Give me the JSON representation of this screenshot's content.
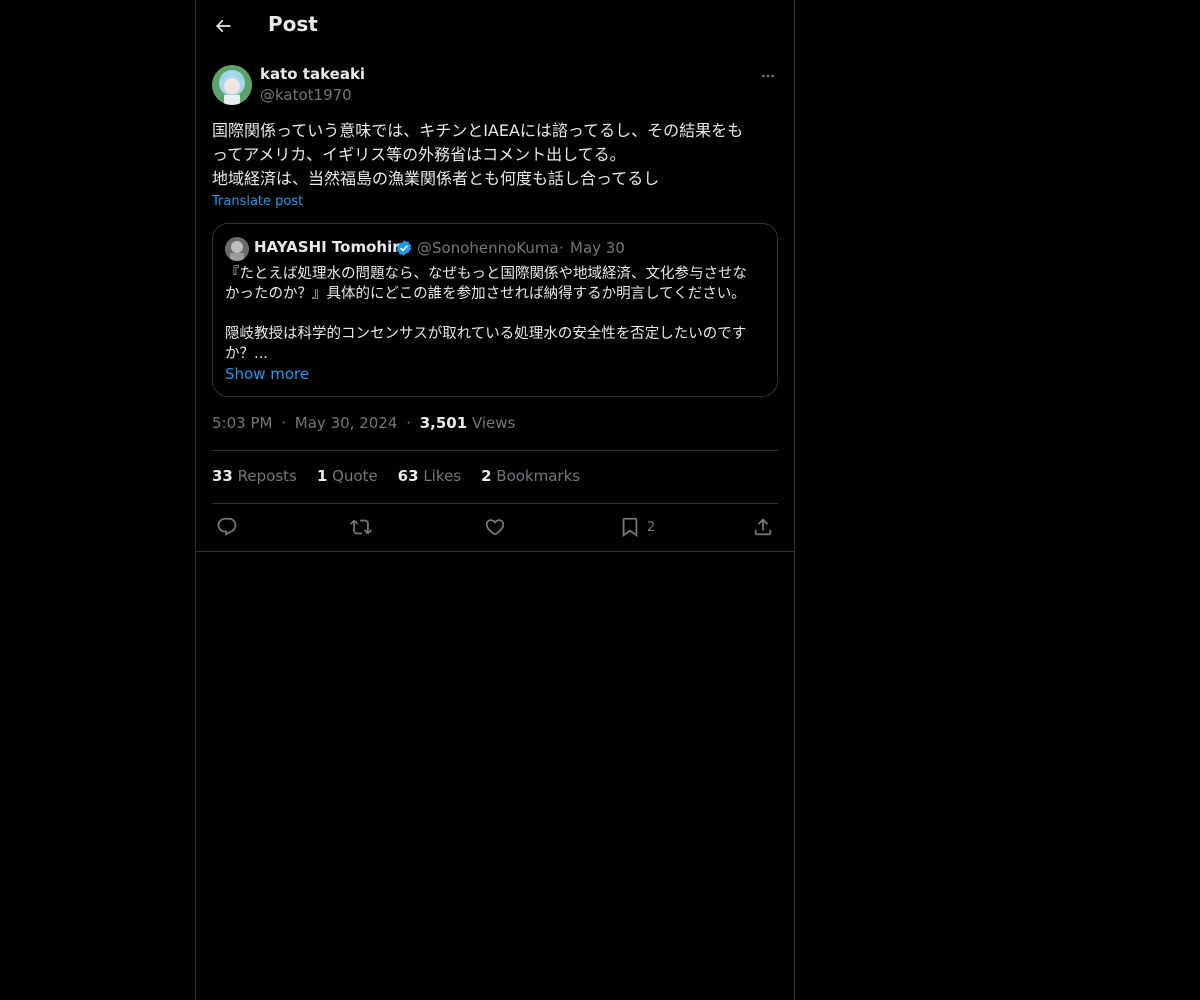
{
  "header": {
    "title": "Post",
    "back_icon": "arrow-left-icon"
  },
  "post": {
    "author_name": "kato takeaki",
    "author_handle": "@katot1970",
    "more_icon": "more-dots-icon",
    "body_lines": [
      "国際関係っていう意味では、キチンとIAEAには諮ってるし、その結果をも",
      "ってアメリカ、イギリス等の外務省はコメント出してる。",
      "地域経済は、当然福島の漁業関係者とも何度も話し合ってるし"
    ],
    "translate_label": "Translate post"
  },
  "quote": {
    "author_name": "HAYASHI Tomohiro",
    "verified_icon": "verified-badge-icon",
    "author_handle": "@SonohennoKuma",
    "separator": "·",
    "date": "May 30",
    "text_lines": [
      "『たとえば処理水の問題なら、なぜもっと国際関係や地域経済、文化参与させな",
      "かったのか？』具体的にどこの誰を参加させれば納得するか明言してください。",
      "",
      "隠岐教授は科学的コンセンサスが取れている処理水の安全性を否定したいのです",
      "か？..."
    ],
    "show_more": "Show more"
  },
  "meta": {
    "time": "5:03 PM",
    "sep": "·",
    "date": "May 30, 2024",
    "views_count": "3,501",
    "views_label": "Views"
  },
  "stats": {
    "reposts_count": "33",
    "reposts_label": "Reposts",
    "quote_count": "1",
    "quote_label": "Quote",
    "likes_count": "63",
    "likes_label": "Likes",
    "bookmarks_count": "2",
    "bookmarks_label": "Bookmarks"
  },
  "actions": {
    "reply_icon": "reply-icon",
    "repost_icon": "repost-icon",
    "like_icon": "heart-icon",
    "bookmark_icon": "bookmark-icon",
    "bookmark_count": "2",
    "share_icon": "share-icon"
  },
  "colors": {
    "background": "#000000",
    "text": "#e7e9ea",
    "muted": "#71767b",
    "accent": "#1d9bf0",
    "border": "#2f3336"
  }
}
